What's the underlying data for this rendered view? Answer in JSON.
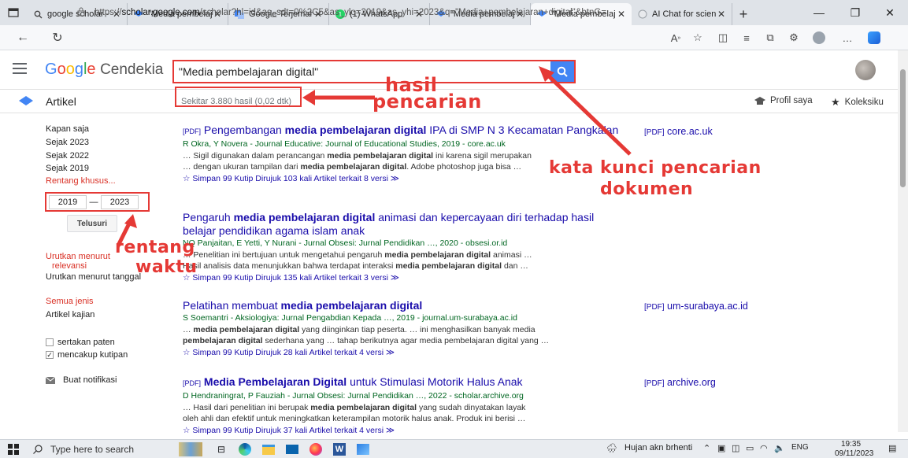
{
  "browser": {
    "tabs": [
      {
        "title": "google scholar - I",
        "icon": "search-icon"
      },
      {
        "title": "\"Media pembelajar",
        "icon": "scholar-cap-icon"
      },
      {
        "title": "Google Terjemah",
        "icon": "translate-icon"
      },
      {
        "title": "(1) WhatsApp",
        "icon": "whatsapp-icon"
      },
      {
        "title": "\"Media pembelajar",
        "icon": "scholar-cap-icon"
      },
      {
        "title": "\"Media pembelajar",
        "icon": "scholar-cap-icon"
      },
      {
        "title": "AI Chat for scient",
        "icon": "ai-chat-icon"
      }
    ],
    "url_prefix": "https://",
    "url_host": "scholar.google.com",
    "url_path": "/scholar?hl=id&as_sdt=0%2C5&as_ylo=2019&as_yhi=2023&q=\"Media+pembelajaran+digital\"&btnG="
  },
  "header": {
    "logo_google": "Google",
    "logo_cendekia": "Cendekia",
    "search_value": "\"Media pembelajaran digital\""
  },
  "subheader": {
    "artikel": "Artikel",
    "result_count": "Sekitar 3.880 hasil (0,02 dtk)",
    "profil": "Profil saya",
    "koleksi": "Koleksiku"
  },
  "sidebar": {
    "time_options": [
      "Kapan saja",
      "Sejak 2023",
      "Sejak 2022",
      "Sejak 2019"
    ],
    "custom_range": "Rentang khusus...",
    "year_from": "2019",
    "year_sep": "—",
    "year_to": "2023",
    "search_button": "Telusuri",
    "sort_relevance_1": "Urutkan menurut",
    "sort_relevance_2": "relevansi",
    "sort_date": "Urutkan menurut tanggal",
    "type_all": "Semua jenis",
    "type_review": "Artikel kajian",
    "include_patents": "sertakan paten",
    "include_citations": "mencakup kutipan",
    "create_alert": "Buat notifikasi"
  },
  "results": [
    {
      "prefix": "[PDF]",
      "title_pre": "Pengembangan ",
      "title_bold": "media pembelajaran digital",
      "title_post": " IPA di SMP N 3 Kecamatan Pangkalan",
      "authors": "R Okra, Y Novera - Journal Educative: Journal of Educational Studies, 2019 - core.ac.uk",
      "snippet_1_pre": "… Sigil digunakan dalam perancangan ",
      "snippet_1_bold": "media pembelajaran digital",
      "snippet_1_post": " ini karena sigil merupakan",
      "snippet_2_pre": "… dengan ukuran tampilan dari ",
      "snippet_2_bold": "media pembelajaran digital",
      "snippet_2_post": ". Adobe photoshop juga bisa …",
      "actions": "☆ Simpan  99 Kutip  Dirujuk 103 kali  Artikel terkait  8 versi  ≫",
      "side_link": "core.ac.uk"
    },
    {
      "title_pre": "Pengaruh ",
      "title_bold": "media pembelajaran digital",
      "title_post": " animasi dan kepercayaan diri terhadap hasil belajar pendidikan agama islam anak",
      "authors": "NQ Panjaitan, E Yetti, Y Nurani - Jurnal Obsesi: Jurnal Pendidikan …, 2020 - obsesi.or.id",
      "snippet_1_pre": "… Penelitian ini bertujuan untuk mengetahui pengaruh ",
      "snippet_1_bold": "media pembelajaran digital",
      "snippet_1_post": " animasi …",
      "snippet_2_pre": "Hasil analisis data menunjukkan bahwa terdapat interaksi ",
      "snippet_2_bold": "media pembelajaran digital",
      "snippet_2_post": " dan …",
      "actions": "☆ Simpan  99 Kutip  Dirujuk 135 kali  Artikel terkait  3 versi  ≫"
    },
    {
      "title_pre": "Pelatihan membuat ",
      "title_bold": "media pembelajaran digital",
      "title_post": "",
      "authors": "S Soemantri - Aksiologiya: Jurnal Pengabdian Kepada …, 2019 - journal.um-surabaya.ac.id",
      "snippet_1_pre": "… ",
      "snippet_1_bold": "media pembelajaran digital",
      "snippet_1_post": " yang diinginkan tiap peserta. … ini menghasilkan banyak media",
      "snippet_2_pre": "",
      "snippet_2_bold": "pembelajaran digital",
      "snippet_2_post": " sederhana yang … tahap berikutnya agar media pembelajaran digital yang …",
      "actions": "☆ Simpan  99 Kutip  Dirujuk 28 kali  Artikel terkait  4 versi  ≫",
      "side_link": "um-surabaya.ac.id"
    },
    {
      "prefix": "[PDF]",
      "title_pre": "",
      "title_bold": "Media Pembelajaran Digital",
      "title_post": " untuk Stimulasi Motorik Halus Anak",
      "authors": "D Hendraningrat, P Fauziah - Jurnal Obsesi: Jurnal Pendidikan …, 2022 - scholar.archive.org",
      "snippet_1_pre": "… Hasil dari penelitian ini berupak ",
      "snippet_1_bold": "media pembelajaran digital",
      "snippet_1_post": " yang sudah dinyatakan layak",
      "snippet_2_pre": "oleh ahli dan efektif untuk meningkatkan keterampilan motorik halus anak. Produk ini berisi …",
      "snippet_2_bold": "",
      "snippet_2_post": "",
      "actions": "☆ Simpan  99 Kutip  Dirujuk 37 kali  Artikel terkait  4 versi  ≫",
      "side_link": "archive.org"
    }
  ],
  "side_pdf_label": "[PDF]",
  "annotations": {
    "hasil": "hasil",
    "pencarian": "pencarian",
    "kata_kunci": "kata kunci pencarian",
    "dokumen": "dokumen",
    "rentang": "rentang",
    "waktu": "waktu"
  },
  "taskbar": {
    "search_placeholder": "Type here to search",
    "weather": "Hujan akn brhenti",
    "lang": "ENG",
    "time": "19:35",
    "date": "09/11/2023"
  },
  "colors": {
    "annotation_red": "#e53935",
    "link_blue": "#1a0dab",
    "author_green": "#006621",
    "accent_blue": "#4285f4"
  }
}
